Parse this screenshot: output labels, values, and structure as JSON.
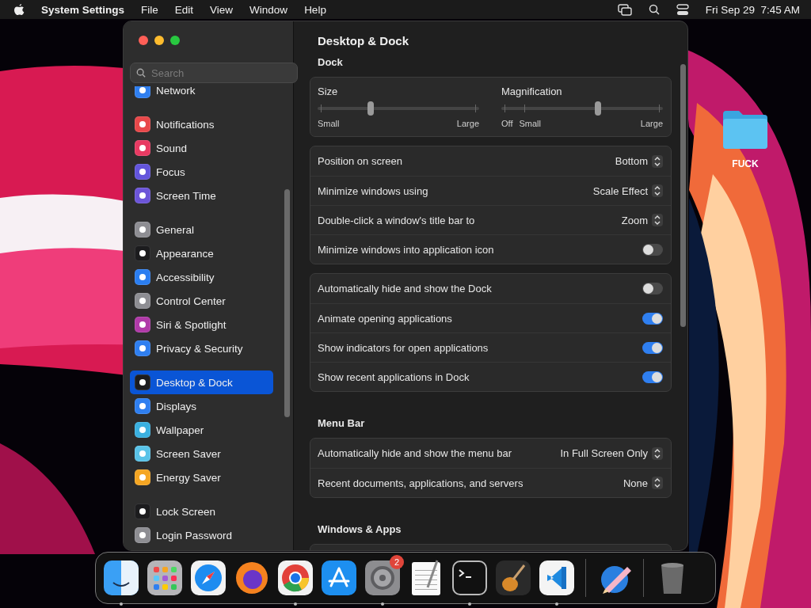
{
  "menu_bar": {
    "app_name": "System Settings",
    "menus": [
      "File",
      "Edit",
      "View",
      "Window",
      "Help"
    ],
    "clock": "Fri Sep 29  7:45 AM"
  },
  "window": {
    "title": "Desktop & Dock",
    "search": {
      "placeholder": "Search"
    },
    "sidebar": {
      "groups": [
        {
          "items": [
            {
              "label": "Network",
              "selected": false,
              "color": "#2f7ff0"
            }
          ]
        },
        {
          "items": [
            {
              "label": "Notifications",
              "selected": false,
              "color": "#e8484a"
            },
            {
              "label": "Sound",
              "selected": false,
              "color": "#e83a62"
            },
            {
              "label": "Focus",
              "selected": false,
              "color": "#6355dc"
            },
            {
              "label": "Screen Time",
              "selected": false,
              "color": "#6c55d8"
            }
          ]
        },
        {
          "items": [
            {
              "label": "General",
              "selected": false,
              "color": "#8e8e93"
            },
            {
              "label": "Appearance",
              "selected": false,
              "color": "#1c1c1e"
            },
            {
              "label": "Accessibility",
              "selected": false,
              "color": "#2b7ef0"
            },
            {
              "label": "Control Center",
              "selected": false,
              "color": "#8e8e93"
            },
            {
              "label": "Siri & Spotlight",
              "selected": false,
              "color": "#b03aa8"
            },
            {
              "label": "Privacy & Security",
              "selected": false,
              "color": "#2f7ff0"
            }
          ]
        },
        {
          "items": [
            {
              "label": "Desktop & Dock",
              "selected": true,
              "color": "#1c1c1e"
            },
            {
              "label": "Displays",
              "selected": false,
              "color": "#2f7ff0"
            },
            {
              "label": "Wallpaper",
              "selected": false,
              "color": "#3bb0e0"
            },
            {
              "label": "Screen Saver",
              "selected": false,
              "color": "#5ac3e8"
            },
            {
              "label": "Energy Saver",
              "selected": false,
              "color": "#f5a623"
            }
          ]
        },
        {
          "items": [
            {
              "label": "Lock Screen",
              "selected": false,
              "color": "#1c1c1e"
            },
            {
              "label": "Login Password",
              "selected": false,
              "color": "#8e8e93"
            }
          ]
        }
      ]
    },
    "sections": [
      {
        "title": "Dock",
        "cards": [
          {
            "kind": "sliders",
            "sliders": [
              {
                "label": "Size",
                "level": 0.32,
                "marks": [
                  "Small",
                  "Large"
                ]
              },
              {
                "label": "Magnification",
                "level": 0.6,
                "marks": [
                  "Off",
                  "Small",
                  "Large"
                ]
              }
            ]
          },
          {
            "kind": "rows",
            "rows": [
              {
                "kind": "popup",
                "label": "Position on screen",
                "value": "Bottom"
              },
              {
                "kind": "popup",
                "label": "Minimize windows using",
                "value": "Scale Effect"
              },
              {
                "kind": "popup",
                "label": "Double-click a window's title bar to",
                "value": "Zoom"
              },
              {
                "kind": "toggle",
                "label": "Minimize windows into application icon",
                "on": false
              }
            ]
          },
          {
            "kind": "rows",
            "rows": [
              {
                "kind": "toggle",
                "label": "Automatically hide and show the Dock",
                "on": false
              },
              {
                "kind": "toggle",
                "label": "Animate opening applications",
                "on": true
              },
              {
                "kind": "toggle",
                "label": "Show indicators for open applications",
                "on": true
              },
              {
                "kind": "toggle",
                "label": "Show recent applications in Dock",
                "on": true
              }
            ]
          }
        ]
      },
      {
        "title": "Menu Bar",
        "cards": [
          {
            "kind": "rows",
            "rows": [
              {
                "kind": "popup",
                "label": "Automatically hide and show the menu bar",
                "value": "In Full Screen Only"
              },
              {
                "kind": "popup",
                "label": "Recent documents, applications, and servers",
                "value": "None"
              }
            ]
          }
        ]
      },
      {
        "title": "Windows & Apps",
        "cards": [
          {
            "kind": "rows"
          }
        ]
      }
    ]
  },
  "desktop": {
    "folder": "FUCK"
  },
  "dock": {
    "apps": [
      {
        "kind": "finder",
        "running": true
      },
      {
        "kind": "grid",
        "running": false
      },
      {
        "kind": "compass",
        "running": false
      },
      {
        "kind": "fox",
        "running": false
      },
      {
        "kind": "chrome",
        "running": true
      },
      {
        "kind": "appstore",
        "running": false
      },
      {
        "kind": "gear",
        "running": true,
        "badge": "2"
      },
      {
        "kind": "notepad",
        "running": false
      },
      {
        "kind": "terminal",
        "running": true
      },
      {
        "kind": "guitar",
        "running": false
      },
      {
        "kind": "code",
        "running": true
      },
      {
        "kind": "separator"
      },
      {
        "kind": "pencil",
        "running": false
      },
      {
        "kind": "separator"
      },
      {
        "kind": "trash",
        "running": false
      }
    ]
  }
}
